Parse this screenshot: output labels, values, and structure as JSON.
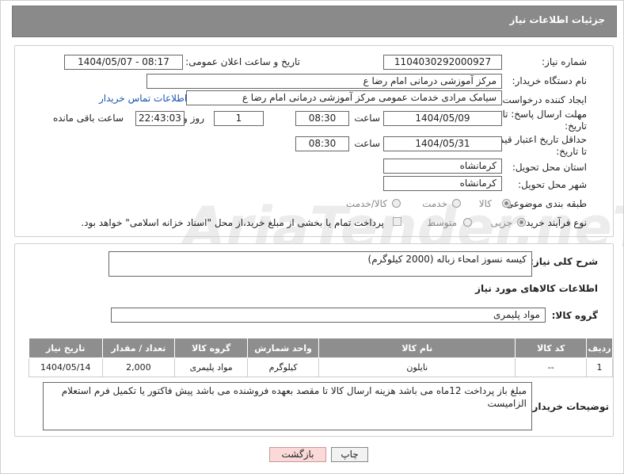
{
  "header": {
    "title": "جزئیات اطلاعات نیاز"
  },
  "form": {
    "need_number_label": "شماره نیاز:",
    "need_number": "1104030292000927",
    "announce_label": "تاریخ و ساعت اعلان عمومی:",
    "announce_value": "1404/05/07 - 08:17",
    "buyer_label": "نام دستگاه خریدار:",
    "buyer_value": "مرکز آموزشی  درمانی امام رضا  ع",
    "creator_label": "ایجاد کننده درخواست:",
    "creator_value": "سیامک مرادی خدمات عمومی مرکز آموزشی  درمانی امام رضا  ع",
    "contact_link": "اطلاعات تماس خریدار",
    "deadline_label_1": "مهلت ارسال پاسخ: تا",
    "deadline_label_2": "تاریخ:",
    "deadline_date": "1404/05/09",
    "time_label": "ساعت",
    "deadline_time": "08:30",
    "days_value": "1",
    "days_label": "روز و",
    "remaining_value": "22:43:03",
    "remaining_label": "ساعت باقی مانده",
    "price_label_1": "حداقل تاریخ اعتبار قیمت:",
    "price_label_2": "تا تاریخ:",
    "price_date": "1404/05/31",
    "price_time": "08:30",
    "province_label": "استان محل تحویل:",
    "province_value": "کرمانشاه",
    "city_label": "شهر محل تحویل:",
    "city_value": "کرمانشاه",
    "category_label": "طبقه بندی موضوعی:",
    "category_options": [
      "کالا",
      "خدمت",
      "کالا/خدمت"
    ],
    "purchase_label": "نوع فرآیند خرید :",
    "purchase_options": [
      "جزیی",
      "متوسط"
    ],
    "payment_note": "پرداخت تمام یا بخشی از مبلغ خرید،از محل \"اسناد خزانه اسلامی\" خواهد بود."
  },
  "description": {
    "label": "شرح کلی نیاز:",
    "value": "کیسه نسوز امحاء زباله  (2000 کیلوگرم)"
  },
  "goods": {
    "section_title": "اطلاعات کالاهای مورد نیاز",
    "group_label": "گروه کالا:",
    "group_value": "مواد پلیمری",
    "columns": [
      "ردیف",
      "کد کالا",
      "نام کالا",
      "واحد شمارش",
      "گروه کالا",
      "تعداد / مقدار",
      "تاریخ نیاز"
    ],
    "rows": [
      [
        "1",
        "--",
        "نایلون",
        "کیلوگرم",
        "مواد پلیمری",
        "2,000",
        "1404/05/14"
      ]
    ]
  },
  "buyer_notes": {
    "label": "توضیحات خریدار:",
    "value": "مبلغ باز پرداخت 12ماه می باشد هزینه ارسال کالا تا مقصد بعهده فروشنده می باشد پیش فاکتور یا تکمیل فرم استعلام الزامیست"
  },
  "buttons": {
    "print": "چاپ",
    "back": "بازگشت"
  },
  "watermark": "AriaTender.neT"
}
